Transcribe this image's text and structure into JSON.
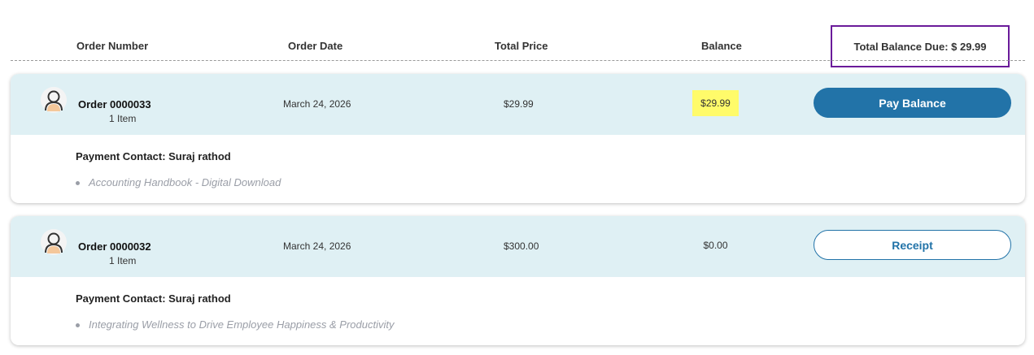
{
  "header": {
    "order_number": "Order Number",
    "order_date": "Order Date",
    "total_price": "Total Price",
    "balance": "Balance",
    "total_balance_due": "Total Balance Due: $ 29.99"
  },
  "orders": [
    {
      "order_label": "Order 0000033",
      "items": "1 Item",
      "date": "March 24, 2026",
      "total": "$29.99",
      "balance": "$29.99",
      "button": "Pay Balance",
      "contact": "Payment Contact: Suraj rathod",
      "product": "Accounting Handbook - Digital Download"
    },
    {
      "order_label": "Order 0000032",
      "items": "1 Item",
      "date": "March 24, 2026",
      "total": "$300.00",
      "balance": "$0.00",
      "button": "Receipt",
      "contact": "Payment Contact: Suraj rathod",
      "product": "Integrating Wellness to Drive Employee Happiness & Productivity"
    }
  ],
  "colors": {
    "row_header_bg": "#dff0f4",
    "primary_button": "#2273a8",
    "balance_highlight": "#fffb6a",
    "due_box_border": "#6a1b9a"
  },
  "icons": {
    "avatar": "user-avatar-icon"
  }
}
